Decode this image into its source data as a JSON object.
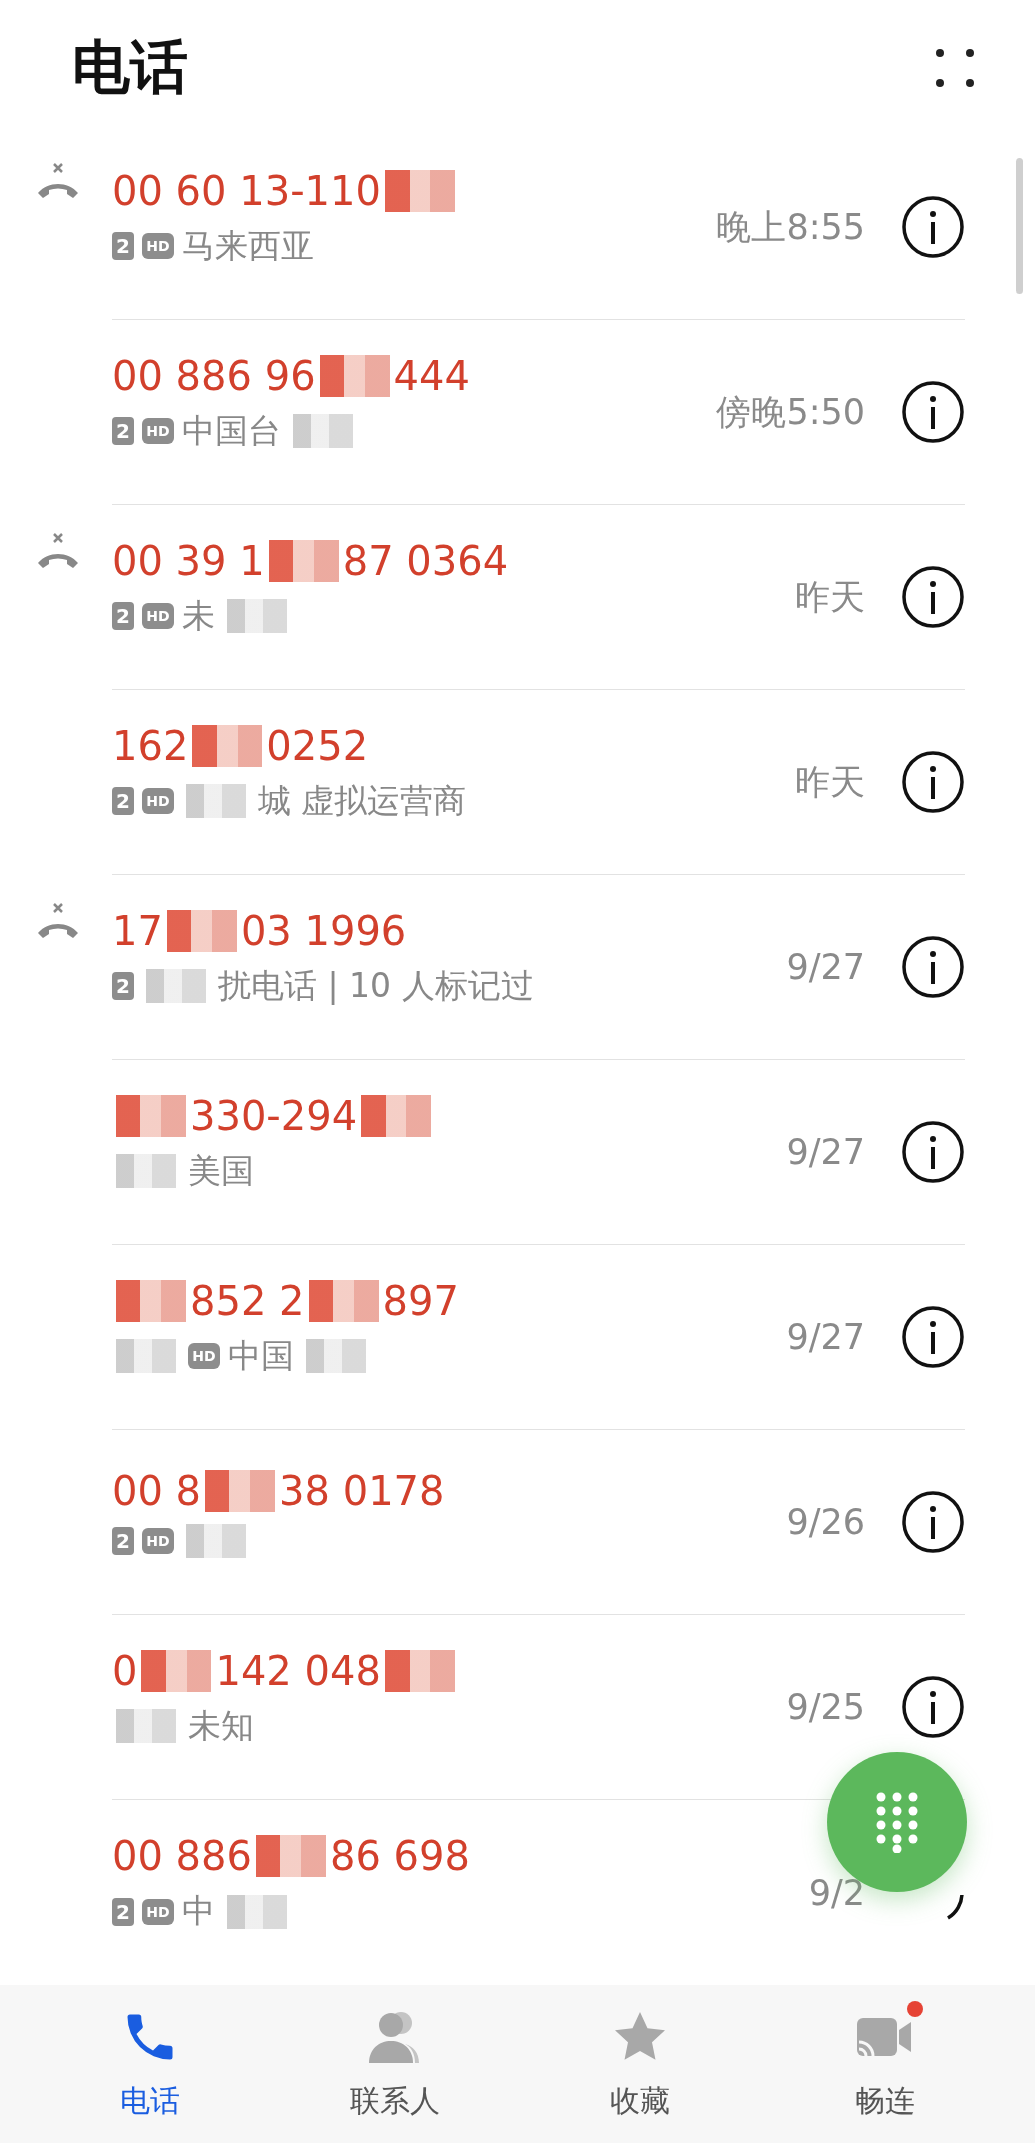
{
  "title": "电话",
  "calls": [
    {
      "missed": true,
      "number": [
        {
          "kind": "text",
          "text": "00 60 13-110"
        },
        {
          "kind": "redacted"
        }
      ],
      "detail": [
        {
          "kind": "sim",
          "text": "2"
        },
        {
          "kind": "hd",
          "text": "HD"
        },
        {
          "kind": "text",
          "text": "马来西亚"
        }
      ],
      "time": "晚上8:55"
    },
    {
      "missed": false,
      "number": [
        {
          "kind": "text",
          "text": "00 886 96"
        },
        {
          "kind": "redacted"
        },
        {
          "kind": "text",
          "text": "444"
        }
      ],
      "detail": [
        {
          "kind": "sim",
          "text": "2"
        },
        {
          "kind": "hd",
          "text": "HD"
        },
        {
          "kind": "text",
          "text": "中国台"
        },
        {
          "kind": "redacted"
        }
      ],
      "time": "傍晚5:50"
    },
    {
      "missed": true,
      "number": [
        {
          "kind": "text",
          "text": "00 39 1"
        },
        {
          "kind": "redacted"
        },
        {
          "kind": "text",
          "text": "87 0364"
        }
      ],
      "detail": [
        {
          "kind": "sim",
          "text": "2"
        },
        {
          "kind": "hd",
          "text": "HD"
        },
        {
          "kind": "text",
          "text": "未"
        },
        {
          "kind": "redacted"
        }
      ],
      "time": "昨天"
    },
    {
      "missed": false,
      "number": [
        {
          "kind": "text",
          "text": "162"
        },
        {
          "kind": "redacted"
        },
        {
          "kind": "text",
          "text": "0252"
        }
      ],
      "detail": [
        {
          "kind": "sim",
          "text": "2"
        },
        {
          "kind": "hd",
          "text": "HD"
        },
        {
          "kind": "redacted"
        },
        {
          "kind": "text",
          "text": "城 虚拟运营商"
        }
      ],
      "time": "昨天"
    },
    {
      "missed": true,
      "number": [
        {
          "kind": "text",
          "text": "17"
        },
        {
          "kind": "redacted"
        },
        {
          "kind": "text",
          "text": "03 1996"
        }
      ],
      "detail": [
        {
          "kind": "sim",
          "text": "2"
        },
        {
          "kind": "redacted"
        },
        {
          "kind": "text",
          "text": "扰电话 | 10 人标记过"
        }
      ],
      "time": "9/27"
    },
    {
      "missed": false,
      "number": [
        {
          "kind": "redacted"
        },
        {
          "kind": "text",
          "text": "330-294"
        },
        {
          "kind": "redacted"
        }
      ],
      "detail": [
        {
          "kind": "redacted"
        },
        {
          "kind": "text",
          "text": "美国"
        }
      ],
      "time": "9/27"
    },
    {
      "missed": false,
      "number": [
        {
          "kind": "redacted"
        },
        {
          "kind": "text",
          "text": "852 2"
        },
        {
          "kind": "redacted"
        },
        {
          "kind": "text",
          "text": "897"
        }
      ],
      "detail": [
        {
          "kind": "redacted"
        },
        {
          "kind": "hd",
          "text": "HD"
        },
        {
          "kind": "text",
          "text": "中国"
        },
        {
          "kind": "redacted"
        }
      ],
      "time": "9/27"
    },
    {
      "missed": false,
      "number": [
        {
          "kind": "text",
          "text": "00 8"
        },
        {
          "kind": "redacted"
        },
        {
          "kind": "text",
          "text": "38 0178"
        }
      ],
      "detail": [
        {
          "kind": "sim",
          "text": "2"
        },
        {
          "kind": "hd",
          "text": "HD"
        },
        {
          "kind": "redacted"
        }
      ],
      "time": "9/26"
    },
    {
      "missed": false,
      "number": [
        {
          "kind": "text",
          "text": "0"
        },
        {
          "kind": "redacted"
        },
        {
          "kind": "text",
          "text": "142 048"
        },
        {
          "kind": "redacted"
        }
      ],
      "detail": [
        {
          "kind": "redacted"
        },
        {
          "kind": "text",
          "text": "未知"
        }
      ],
      "time": "9/25"
    },
    {
      "missed": false,
      "number": [
        {
          "kind": "text",
          "text": "00 886"
        },
        {
          "kind": "redacted"
        },
        {
          "kind": "text",
          "text": "86 698"
        }
      ],
      "detail": [
        {
          "kind": "sim",
          "text": "2"
        },
        {
          "kind": "hd",
          "text": "HD"
        },
        {
          "kind": "text",
          "text": "中"
        },
        {
          "kind": "redacted"
        }
      ],
      "time": "9/2"
    }
  ],
  "tabs": [
    {
      "label": "电话",
      "selected": true,
      "badge": false
    },
    {
      "label": "联系人",
      "selected": false,
      "badge": false
    },
    {
      "label": "收藏",
      "selected": false,
      "badge": false
    },
    {
      "label": "畅连",
      "selected": false,
      "badge": true
    }
  ]
}
